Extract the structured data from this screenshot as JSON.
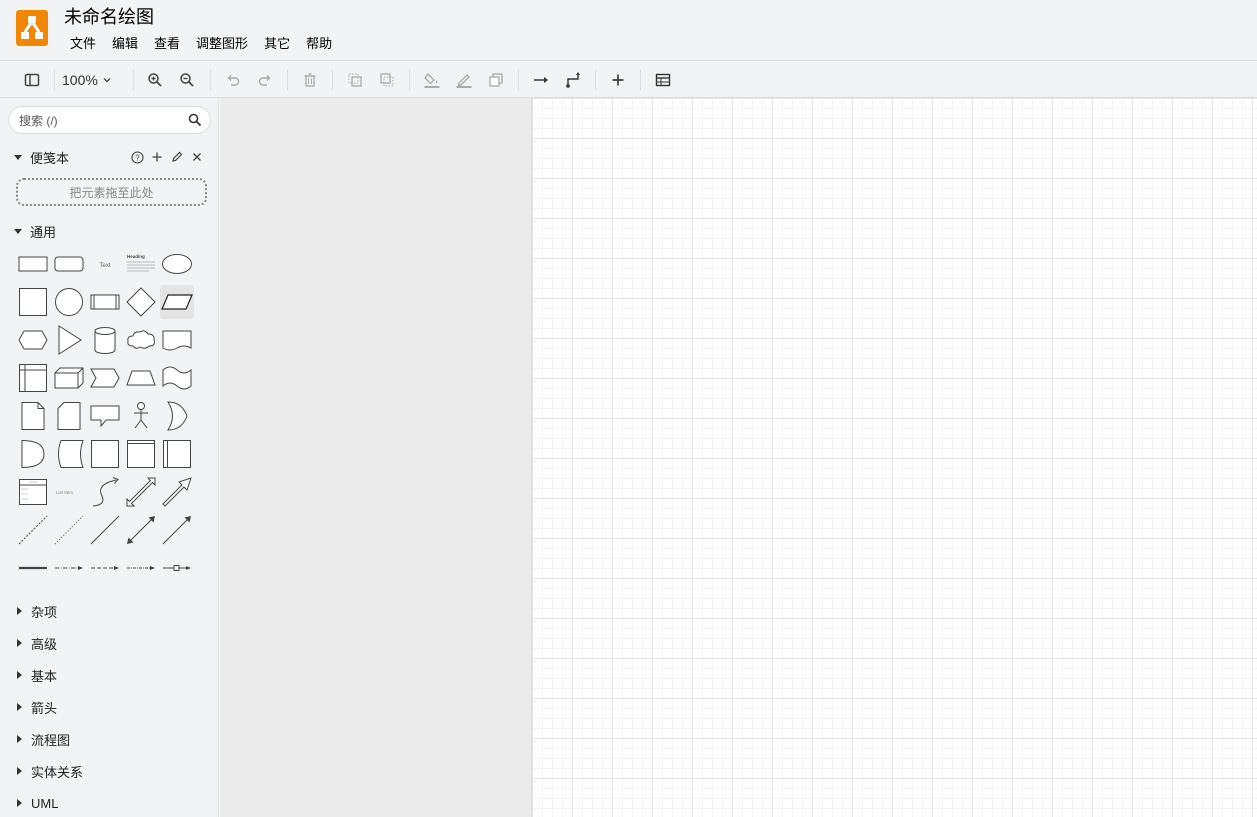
{
  "app": {
    "title": "未命名绘图",
    "brand_color": "#f08705"
  },
  "menu": [
    "文件",
    "编辑",
    "查看",
    "调整图形",
    "其它",
    "帮助"
  ],
  "toolbar": {
    "zoom_level": "100%",
    "icons": [
      "sidebar-toggle-icon",
      "zoom-in-icon",
      "zoom-out-icon",
      "undo-icon",
      "redo-icon",
      "delete-icon",
      "to-front-icon",
      "to-back-icon",
      "fill-color-icon",
      "line-color-icon",
      "shadow-icon",
      "connection-icon",
      "waypoints-icon",
      "insert-icon",
      "table-icon"
    ]
  },
  "sidebar": {
    "search_placeholder": "搜索 (/)",
    "scratchpad": {
      "title": "便笺本",
      "drop_hint": "把元素拖至此处"
    },
    "general": {
      "title": "通用",
      "text_shape_label": "Text",
      "heading_shape_label": "Heading",
      "list_item_label": "List Item"
    },
    "collapsed_sections": [
      "杂项",
      "高级",
      "基本",
      "箭头",
      "流程图",
      "实体关系",
      "UML"
    ]
  }
}
